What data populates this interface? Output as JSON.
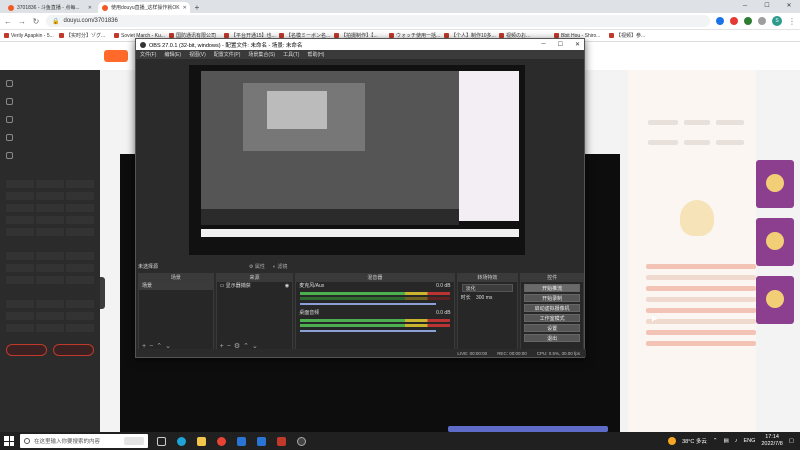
{
  "browser": {
    "tabs": [
      {
        "title": "3701836 - 斗鱼直播 - 点每..."
      },
      {
        "title": "使用douyu直播_这样操作就OK"
      }
    ],
    "new_tab": "+",
    "url": "douyu.com/3701836",
    "avatar_letter": "S",
    "bookmarks": [
      "Verily Apapkin - 5...",
      "【实时分】ゾグ...",
      "Soviet March - Ku...",
      "国防通讯有限公司",
      "【平台开通15】也...",
      "【名模ミーボン名...",
      "【拍摄制作】【...",
      "ウォッチ使用一括...",
      "【个人】制作10多...",
      "视频のお...",
      "Bbit Hou - Shiro...",
      "【视频】参..."
    ]
  },
  "obs": {
    "title": "OBS 27.0.1 (32-bit, windows) - 配置文件: 未命名 - 场景: 未命名",
    "menu": [
      "文件(F)",
      "编辑(E)",
      "视图(V)",
      "配置文件(P)",
      "场景集合(S)",
      "工具(T)",
      "帮助(H)"
    ],
    "no_source_label": "未选择源",
    "props_btn": "属性",
    "filters_btn": "滤镜",
    "docks": {
      "scenes": {
        "header": "场景",
        "items": [
          "场景"
        ]
      },
      "sources": {
        "header": "来源",
        "items": [
          "显示器捕获"
        ]
      },
      "mixer": {
        "header": "混音器",
        "channels": [
          {
            "name": "麦克风/Aux",
            "db": "0.0 dB"
          },
          {
            "name": "桌面音频",
            "db": "0.0 dB"
          }
        ]
      },
      "transitions": {
        "header": "转场特效",
        "type": "淡化",
        "duration_label": "时长",
        "duration": "300 ms"
      },
      "controls": {
        "header": "控件",
        "buttons": [
          "开始推流",
          "开始录制",
          "启动虚拟摄像机",
          "工作室模式",
          "设置",
          "退出"
        ]
      }
    },
    "status": {
      "live": "LIVE: 00:00:00",
      "rec": "REC: 00:00:00",
      "cpu": "CPU: 0.5%, 30.00 fps"
    }
  },
  "taskbar": {
    "search_placeholder": "在这里输入你要搜索的内容",
    "weather": "38°C 多云",
    "lang": "ENG",
    "time": "17:14",
    "date": "2022/7/8"
  }
}
